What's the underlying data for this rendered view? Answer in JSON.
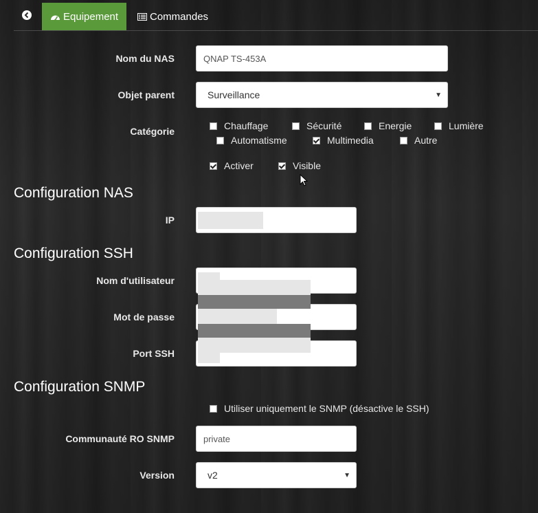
{
  "tabs": {
    "back_icon": "arrow-circle-left-icon",
    "equipment": {
      "label": "Equipement",
      "icon": "dashboard-icon"
    },
    "commands": {
      "label": "Commandes",
      "icon": "list-alt-icon"
    },
    "active_color": "#5a9a3a"
  },
  "form": {
    "nas_name": {
      "label": "Nom du NAS",
      "value": "QNAP TS-453A"
    },
    "parent": {
      "label": "Objet parent",
      "value": "Surveillance"
    },
    "category": {
      "label": "Catégorie",
      "options": [
        {
          "label": "Chauffage",
          "checked": false
        },
        {
          "label": "Sécurité",
          "checked": false
        },
        {
          "label": "Energie",
          "checked": false
        },
        {
          "label": "Lumière",
          "checked": false
        },
        {
          "label": "Automatisme",
          "checked": false
        },
        {
          "label": "Multimedia",
          "checked": true
        },
        {
          "label": "Autre",
          "checked": false
        }
      ]
    },
    "activate": {
      "label": "Activer",
      "checked": true
    },
    "visible": {
      "label": "Visible",
      "checked": true
    }
  },
  "nas_config": {
    "title": "Configuration NAS",
    "ip": {
      "label": "IP",
      "value": ""
    }
  },
  "ssh_config": {
    "title": "Configuration SSH",
    "username": {
      "label": "Nom d'utilisateur",
      "value": ""
    },
    "password": {
      "label": "Mot de passe",
      "value": ""
    },
    "port": {
      "label": "Port SSH",
      "value": ""
    }
  },
  "snmp_config": {
    "title": "Configuration SNMP",
    "only_snmp": {
      "label": "Utiliser uniquement le SNMP (désactive le SSH)",
      "checked": false
    },
    "community": {
      "label": "Communauté RO SNMP",
      "value": "private"
    },
    "version": {
      "label": "Version",
      "value": "v2"
    }
  }
}
